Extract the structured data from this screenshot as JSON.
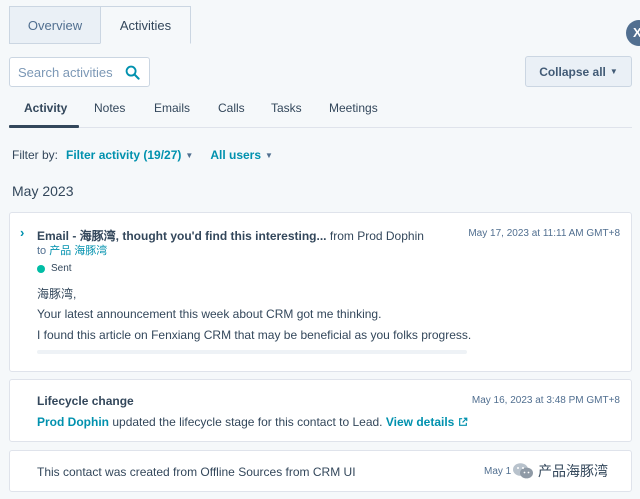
{
  "top_tabs": [
    "Overview",
    "Activities"
  ],
  "close_glyph": "X",
  "search": {
    "placeholder": "Search activities"
  },
  "collapse_label": "Collapse all",
  "sub_tabs": [
    "Activity",
    "Notes",
    "Emails",
    "Calls",
    "Tasks",
    "Meetings"
  ],
  "filter": {
    "label": "Filter by:",
    "activity": "Filter activity (19/27)",
    "users": "All users"
  },
  "month": "May 2023",
  "email_card": {
    "title": "Email - 海豚湾, thought you'd find this interesting...",
    "from": "from Prod Dophin",
    "date": "May 17, 2023 at 11:11 AM GMT+8",
    "to_prefix": "to",
    "to_name": "产品 海豚湾",
    "status": "Sent",
    "lines": [
      "海豚湾,",
      "Your latest announcement this week about CRM got me thinking.",
      "I found this article on Fenxiang CRM that may be beneficial as you folks progress."
    ]
  },
  "lifecycle_card": {
    "title": "Lifecycle change",
    "date": "May 16, 2023 at 3:48 PM GMT+8",
    "person": "Prod Dophin",
    "text": "updated the lifecycle stage for this contact to Lead.",
    "link": "View details"
  },
  "created_card": {
    "text": "This contact was created from Offline Sources from CRM UI",
    "date": "May 1"
  },
  "watermark": "产品海豚湾",
  "colors": {
    "accent": "#0091ae",
    "text": "#33475b",
    "sent": "#00bda5"
  }
}
